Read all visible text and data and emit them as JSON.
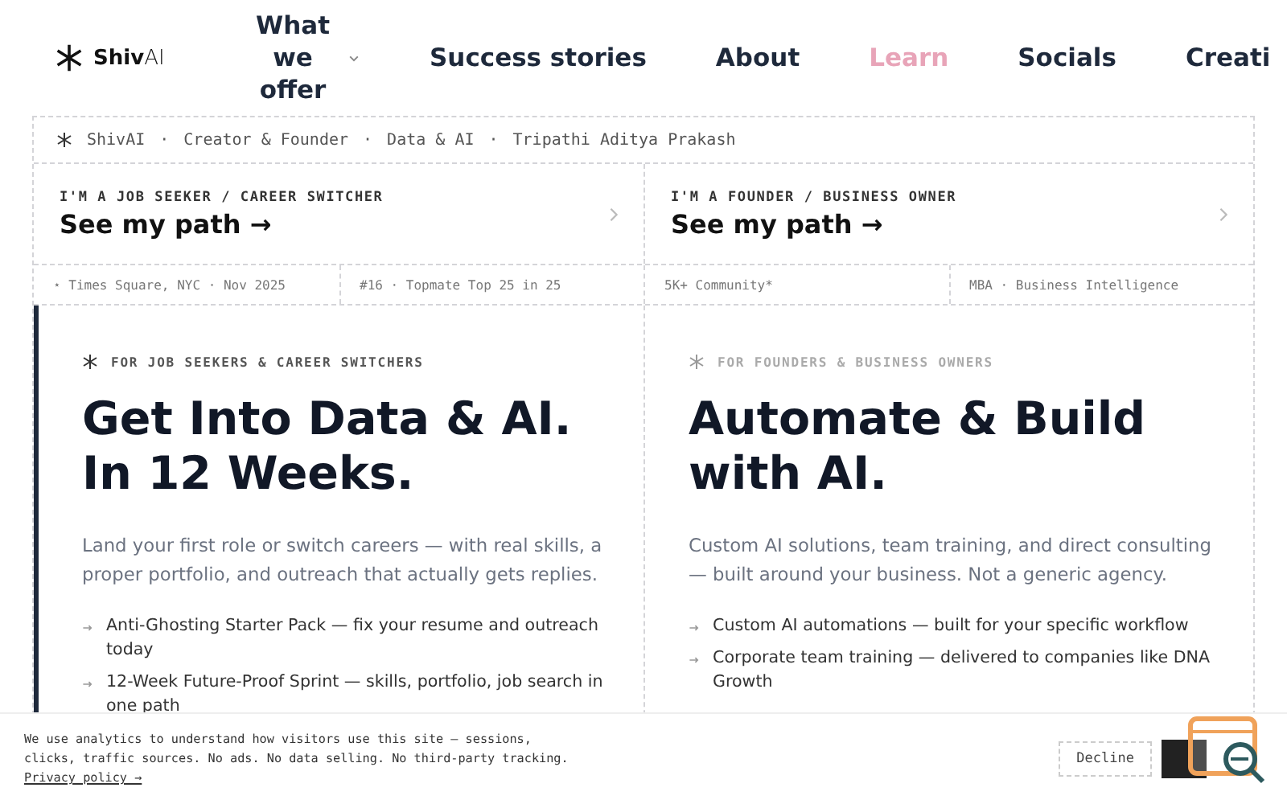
{
  "logo": {
    "text": "**Shiv**AI"
  },
  "nav": [
    {
      "label": "What we offer",
      "has_menu": true,
      "selected": false
    },
    {
      "label": "Success stories",
      "has_menu": false,
      "selected": false
    },
    {
      "label": "About",
      "has_menu": false,
      "selected": false
    },
    {
      "label": "Learn",
      "has_menu": false,
      "selected": true
    },
    {
      "label": "Socials",
      "has_menu": false,
      "selected": false
    },
    {
      "label": "Creati",
      "has_menu": false,
      "selected": false
    }
  ],
  "breadcrumb": {
    "separator": "·",
    "items": [
      "ShivAI",
      "Creator & Founder",
      "Data & AI",
      "Tripathi Aditya Prakash"
    ]
  },
  "paths": [
    {
      "eyebrow": "I'M A JOB SEEKER / CAREER SWITCHER",
      "title": "See my path →"
    },
    {
      "eyebrow": "I'M A FOUNDER / BUSINESS OWNER",
      "title": "See my path →"
    }
  ],
  "stats": [
    "⋆ Times Square, NYC · Nov 2025",
    "#16 · Topmate Top 25 in 25",
    "5K+ Community*",
    "MBA · Business Intelligence"
  ],
  "panels": [
    {
      "selected": true,
      "tag": "FOR JOB SEEKERS & CAREER SWITCHERS",
      "headline": [
        "Get Into Data & AI.",
        "In 12 Weeks."
      ],
      "lead": "Land your first role or switch careers — with real skills, a proper portfolio, and outreach that actually gets replies.",
      "bullets": [
        "Anti-Ghosting Starter Pack — fix your resume and outreach today",
        "12-Week Future-Proof Sprint — skills, portfolio, job search in one path"
      ]
    },
    {
      "selected": false,
      "tag": "FOR FOUNDERS & BUSINESS OWNERS",
      "headline": [
        "Automate & Build",
        "with AI."
      ],
      "lead": "Custom AI solutions, team training, and direct consulting — built around your business. Not a generic agency.",
      "bullets": [
        "Custom AI automations — built for your specific workflow",
        "Corporate team training — delivered to companies like DNA Growth"
      ]
    }
  ],
  "cookie": {
    "text": "We use analytics to understand how visitors use this site — sessions, clicks, traffic sources. No ads. No data selling. No third-party tracking.",
    "link": "Privacy policy →",
    "decline": "Decline"
  }
}
